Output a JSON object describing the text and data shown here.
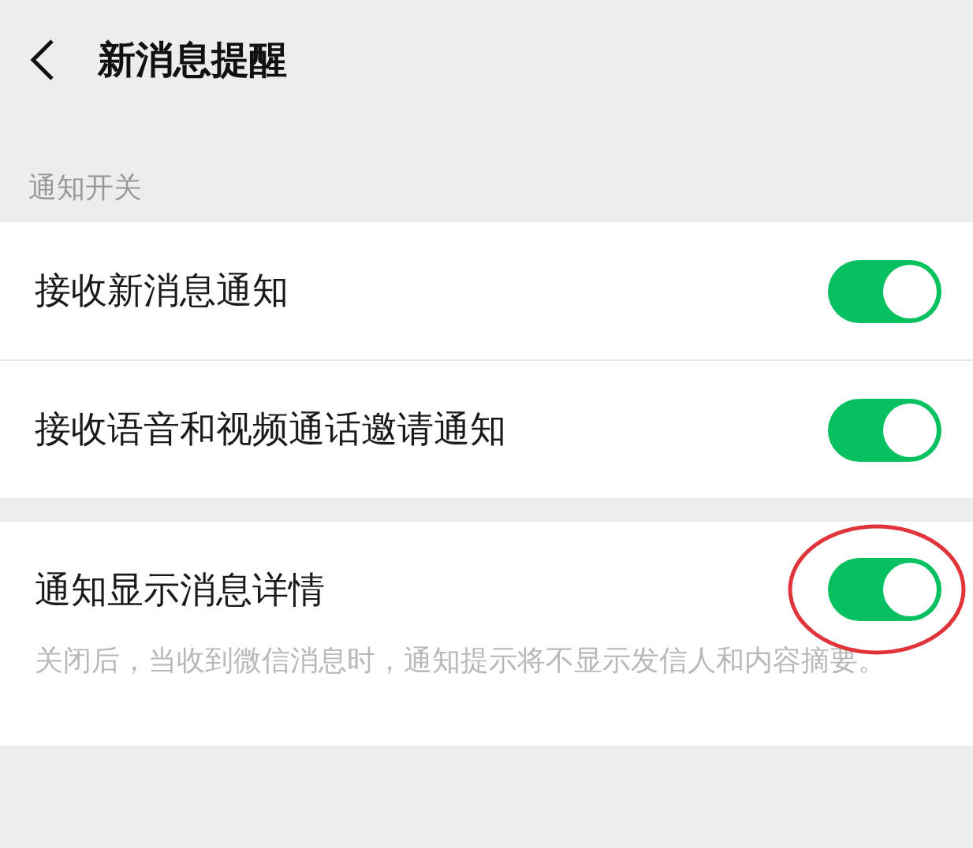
{
  "header": {
    "title": "新消息提醒"
  },
  "sections": [
    {
      "label": "通知开关",
      "rows": [
        {
          "title": "接收新消息通知",
          "on": true
        },
        {
          "title": "接收语音和视频通话邀请通知",
          "on": true
        }
      ]
    },
    {
      "rows": [
        {
          "title": "通知显示消息详情",
          "on": true,
          "description": "关闭后，当收到微信消息时，通知提示将不显示发信人和内容摘要。",
          "highlighted": true
        }
      ]
    }
  ]
}
